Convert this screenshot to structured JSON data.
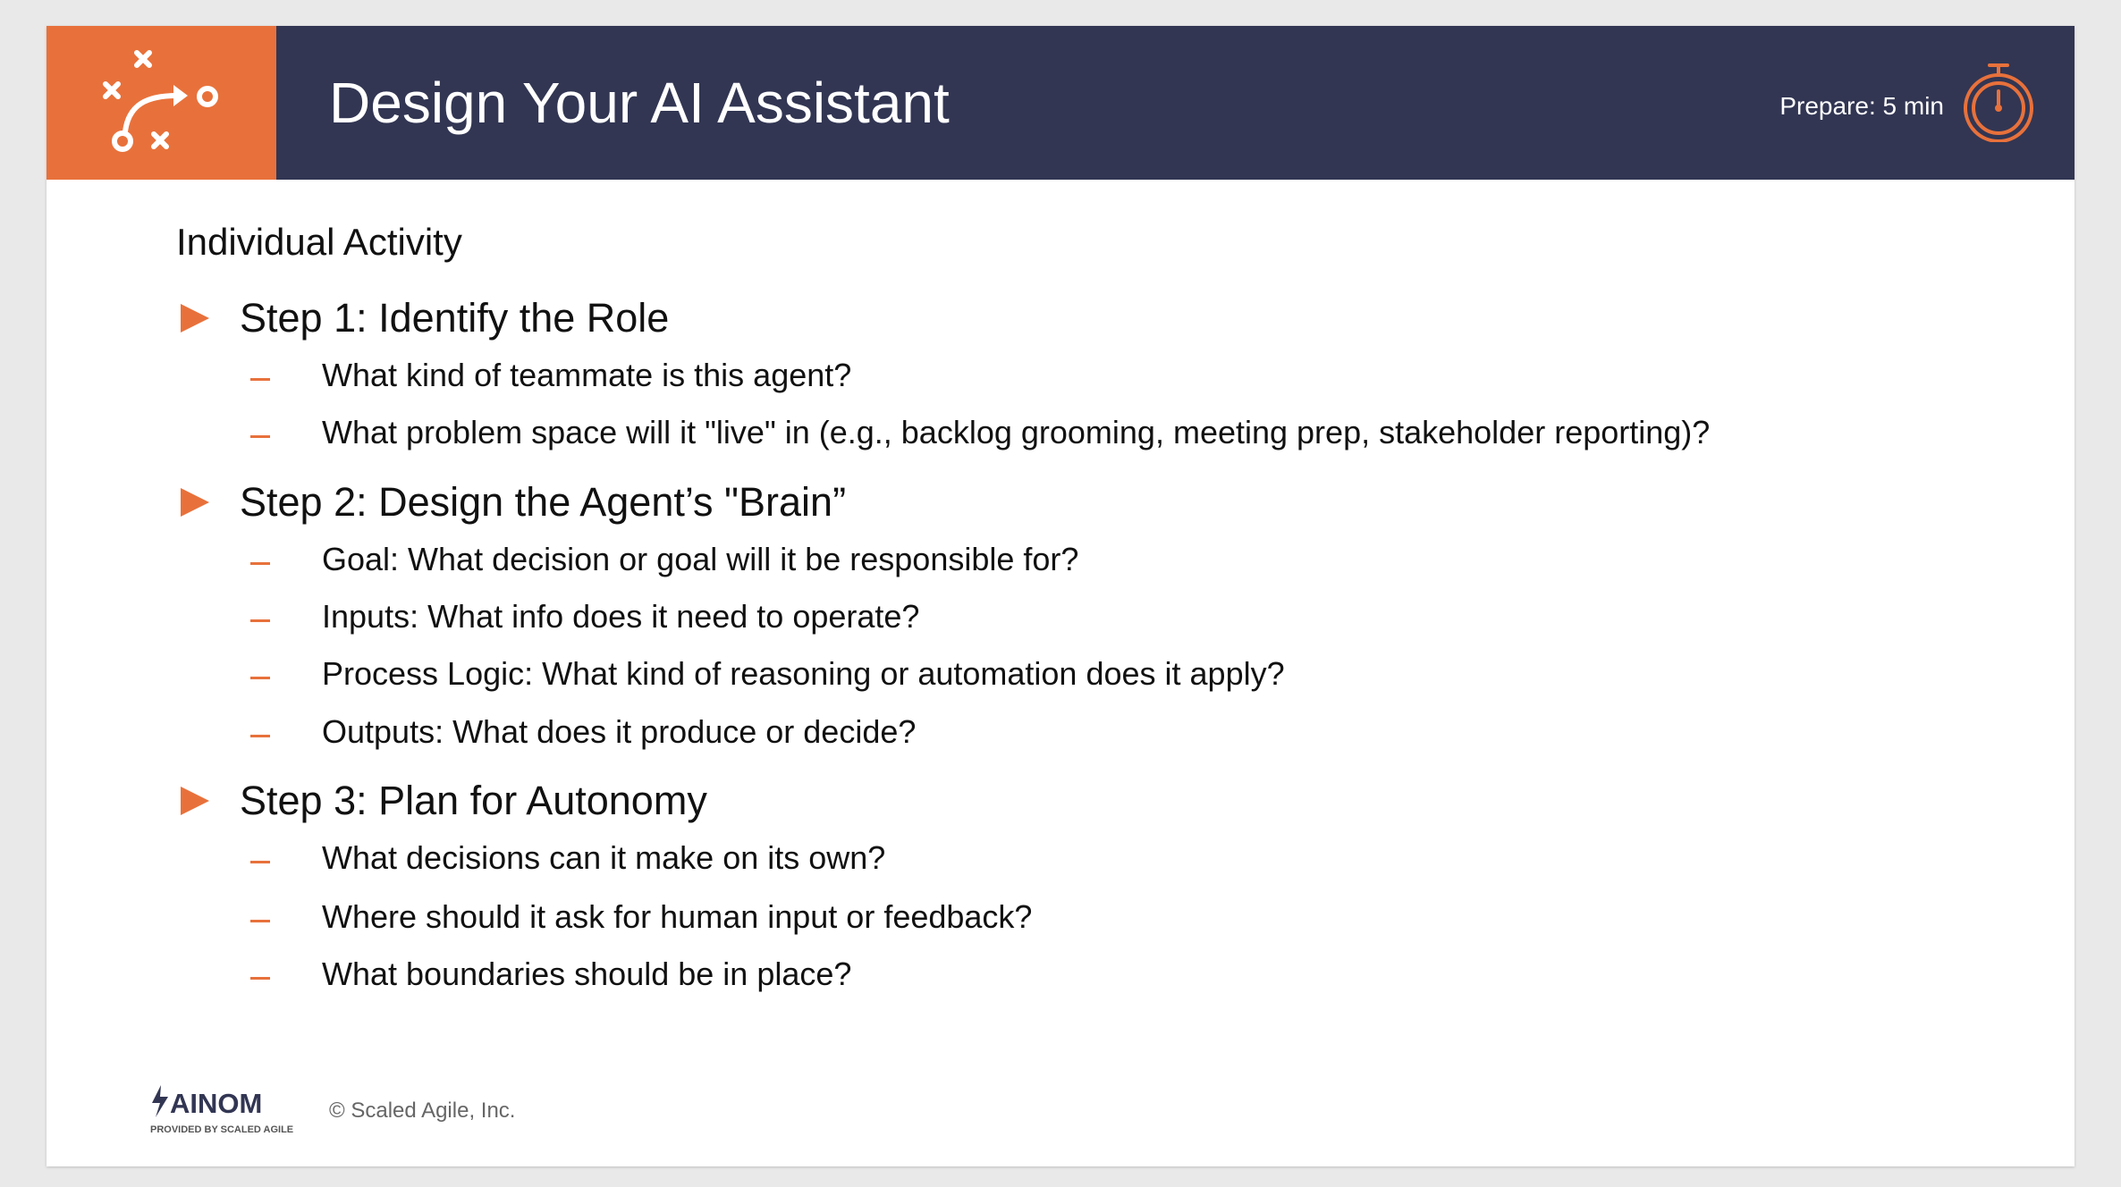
{
  "header": {
    "title": "Design Your AI Assistant",
    "prepare": "Prepare: 5 min",
    "logo_icon": "play-diagram-icon",
    "timer_icon": "stopwatch-icon"
  },
  "content": {
    "activity_title": "Individual Activity",
    "steps": [
      {
        "label": "Step 1: Identify the Role",
        "items": [
          "What kind of teammate is this agent?",
          "What problem space will it \"live\" in (e.g., backlog grooming, meeting prep, stakeholder reporting)?"
        ]
      },
      {
        "label": "Step 2: Design the Agent’s \"Brain”",
        "items": [
          "Goal: What decision or goal will it be responsible for?",
          "Inputs: What info does it need to operate?",
          "Process Logic: What kind of reasoning or automation does it apply?",
          "Outputs: What does it produce or decide?"
        ]
      },
      {
        "label": "Step 3: Plan for Autonomy",
        "items": [
          "What decisions can it make on its own?",
          "Where should it ask for human input or feedback?",
          "What boundaries should be in place?"
        ]
      }
    ]
  },
  "footer": {
    "brand": "AINOM",
    "brand_tagline": "PROVIDED BY SCALED AGILE",
    "copyright": "© Scaled Agile, Inc."
  },
  "colors": {
    "accent": "#e8713b",
    "header_bg": "#323653",
    "text": "#111111"
  }
}
